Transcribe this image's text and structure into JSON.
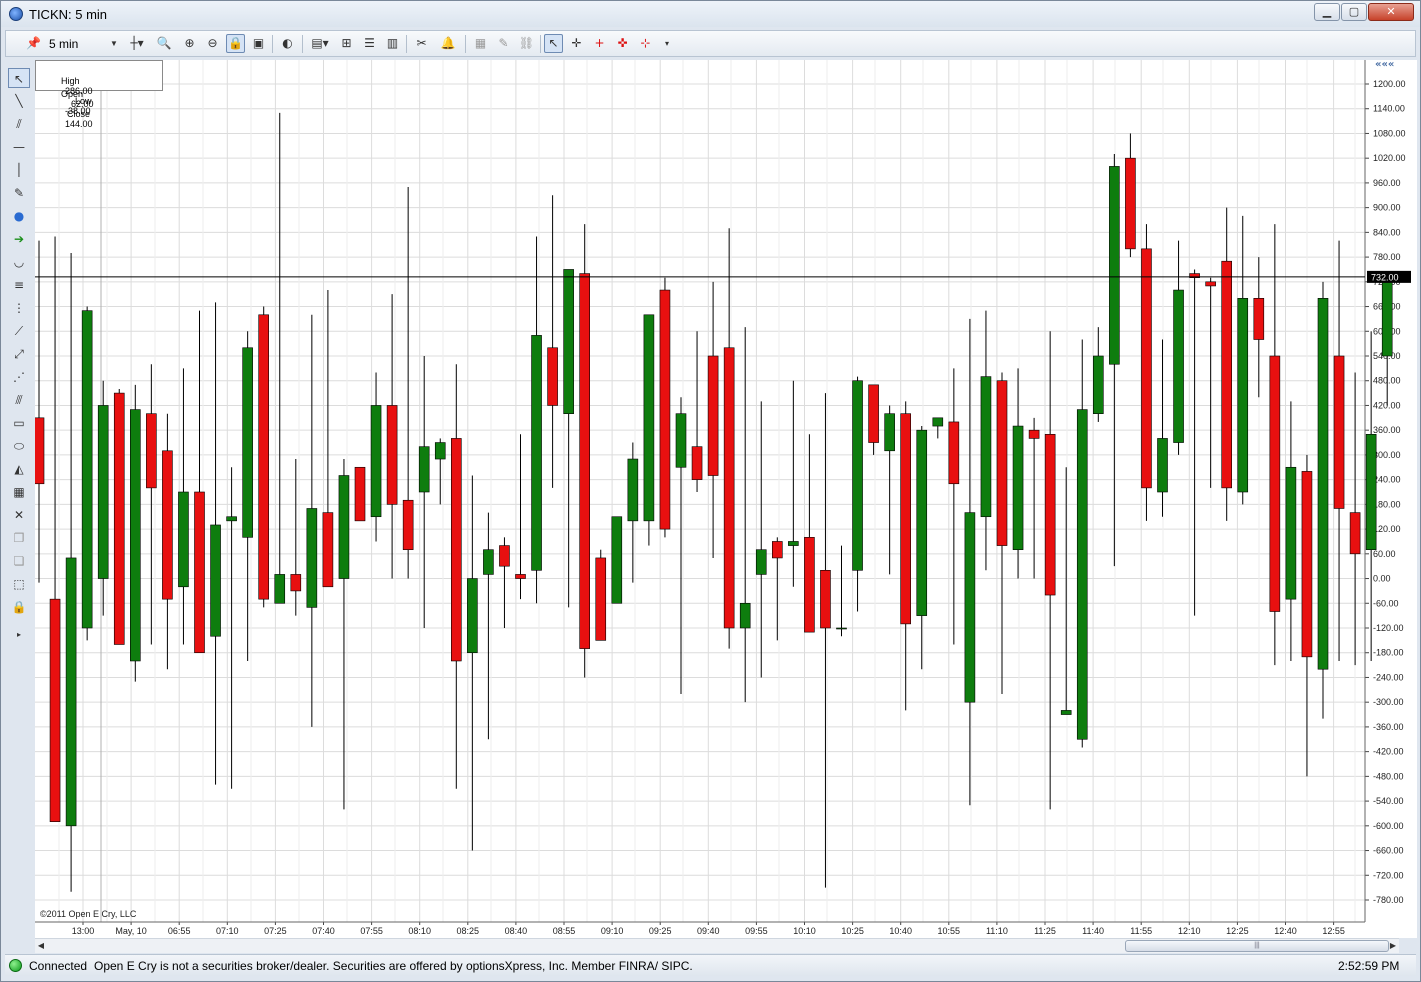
{
  "window": {
    "title": "TICKN: 5 min"
  },
  "toolbar": {
    "interval": "5 min"
  },
  "ohlc": {
    "high_label": "High",
    "high": "286.00",
    "low_label": "Low",
    "low": "-38.00",
    "open_label": "Open",
    "open": "62.00",
    "close_label": "Close",
    "close": "144.00"
  },
  "copyright": "©2011 Open E Cry, LLC",
  "last_price_label": "732.00",
  "status": {
    "connection": "Connected",
    "message": "Open E Cry is not a securities broker/dealer. Securities are offered by optionsXpress, Inc. Member FINRA/ SIPC.",
    "time": "2:52:59 PM"
  },
  "colors": {
    "up": "#0e7d0e",
    "down": "#e81010",
    "grid": "#dcdcdc"
  },
  "chart_data": {
    "type": "candlestick",
    "title": "TICKN: 5 min",
    "ylim": [
      -780,
      1200
    ],
    "y_ticks": [
      1200,
      1140,
      1080,
      1020,
      960,
      900,
      840,
      780,
      720,
      660,
      600,
      540,
      480,
      420,
      360,
      300,
      240,
      180,
      120,
      60,
      0,
      -60,
      -120,
      -180,
      -240,
      -300,
      -360,
      -420,
      -480,
      -540,
      -600,
      -660,
      -720,
      -780
    ],
    "x_labels": [
      "13:00",
      "May, 10",
      "06:55",
      "07:10",
      "07:25",
      "07:40",
      "07:55",
      "08:10",
      "08:25",
      "08:40",
      "08:55",
      "09:10",
      "09:25",
      "09:40",
      "09:55",
      "10:10",
      "10:25",
      "10:40",
      "10:55",
      "11:10",
      "11:25",
      "11:40",
      "11:55",
      "12:10",
      "12:25",
      "12:40",
      "12:55"
    ],
    "horizontal_line": 732,
    "grid": true,
    "candles": [
      {
        "o": 390,
        "h": 820,
        "l": -10,
        "c": 230
      },
      {
        "o": -50,
        "h": 830,
        "l": -590,
        "c": -590
      },
      {
        "o": -600,
        "h": 790,
        "l": -760,
        "c": 50
      },
      {
        "o": -120,
        "h": 660,
        "l": -150,
        "c": 650
      },
      {
        "o": 0,
        "h": 480,
        "l": -90,
        "c": 420
      },
      {
        "o": 450,
        "h": 460,
        "l": -160,
        "c": -160
      },
      {
        "o": -200,
        "h": 470,
        "l": -250,
        "c": 410
      },
      {
        "o": 400,
        "h": 520,
        "l": -160,
        "c": 220
      },
      {
        "o": 310,
        "h": 400,
        "l": -220,
        "c": -50
      },
      {
        "o": -20,
        "h": 510,
        "l": -160,
        "c": 210
      },
      {
        "o": 210,
        "h": 650,
        "l": -40,
        "c": -180
      },
      {
        "o": -140,
        "h": 670,
        "l": -500,
        "c": 130
      },
      {
        "o": 140,
        "h": 270,
        "l": -510,
        "c": 150
      },
      {
        "o": 100,
        "h": 600,
        "l": -200,
        "c": 560
      },
      {
        "o": 640,
        "h": 660,
        "l": -70,
        "c": -50
      },
      {
        "o": -60,
        "h": 1130,
        "l": -60,
        "c": 10
      },
      {
        "o": 10,
        "h": 290,
        "l": -90,
        "c": -30
      },
      {
        "o": -70,
        "h": 640,
        "l": -360,
        "c": 170
      },
      {
        "o": 160,
        "h": 700,
        "l": -10,
        "c": -20
      },
      {
        "o": 0,
        "h": 290,
        "l": -560,
        "c": 250
      },
      {
        "o": 270,
        "h": 270,
        "l": 170,
        "c": 140
      },
      {
        "o": 150,
        "h": 500,
        "l": 90,
        "c": 420
      },
      {
        "o": 420,
        "h": 690,
        "l": 0,
        "c": 180
      },
      {
        "o": 190,
        "h": 950,
        "l": 0,
        "c": 70
      },
      {
        "o": 210,
        "h": 540,
        "l": -120,
        "c": 320
      },
      {
        "o": 290,
        "h": 340,
        "l": 180,
        "c": 330
      },
      {
        "o": 340,
        "h": 520,
        "l": -510,
        "c": -200
      },
      {
        "o": -180,
        "h": 250,
        "l": -660,
        "c": 0
      },
      {
        "o": 10,
        "h": 160,
        "l": -390,
        "c": 70
      },
      {
        "o": 80,
        "h": 100,
        "l": -120,
        "c": 30
      },
      {
        "o": 10,
        "h": 350,
        "l": -50,
        "c": 0
      },
      {
        "o": 20,
        "h": 830,
        "l": -60,
        "c": 590
      },
      {
        "o": 560,
        "h": 930,
        "l": 220,
        "c": 420
      },
      {
        "o": 400,
        "h": 750,
        "l": -70,
        "c": 750
      },
      {
        "o": 740,
        "h": 860,
        "l": -240,
        "c": -170
      },
      {
        "o": 50,
        "h": 70,
        "l": -150,
        "c": -150
      },
      {
        "o": -60,
        "h": 130,
        "l": -40,
        "c": 150
      },
      {
        "o": 140,
        "h": 330,
        "l": -10,
        "c": 290
      },
      {
        "o": 140,
        "h": 350,
        "l": 80,
        "c": 640
      },
      {
        "o": 700,
        "h": 730,
        "l": 100,
        "c": 120
      },
      {
        "o": 270,
        "h": 440,
        "l": -280,
        "c": 400
      },
      {
        "o": 320,
        "h": 600,
        "l": 210,
        "c": 240
      },
      {
        "o": 540,
        "h": 720,
        "l": 50,
        "c": 250
      },
      {
        "o": 560,
        "h": 850,
        "l": -170,
        "c": -120
      },
      {
        "o": -120,
        "h": 610,
        "l": -300,
        "c": -60
      },
      {
        "o": 10,
        "h": 430,
        "l": -240,
        "c": 70
      },
      {
        "o": 90,
        "h": 100,
        "l": -150,
        "c": 50
      },
      {
        "o": 80,
        "h": 480,
        "l": -20,
        "c": 90
      },
      {
        "o": 100,
        "h": 350,
        "l": -130,
        "c": -130
      },
      {
        "o": 20,
        "h": 450,
        "l": -750,
        "c": -120
      },
      {
        "o": -120,
        "h": 80,
        "l": -140,
        "c": -120
      },
      {
        "o": 20,
        "h": 490,
        "l": -80,
        "c": 480
      },
      {
        "o": 470,
        "h": 460,
        "l": 300,
        "c": 330
      },
      {
        "o": 310,
        "h": 420,
        "l": 10,
        "c": 400
      },
      {
        "o": 400,
        "h": 430,
        "l": -320,
        "c": -110
      },
      {
        "o": -90,
        "h": 370,
        "l": -220,
        "c": 360
      },
      {
        "o": 370,
        "h": 390,
        "l": 340,
        "c": 390
      },
      {
        "o": 380,
        "h": 510,
        "l": -160,
        "c": 230
      },
      {
        "o": -300,
        "h": 630,
        "l": -550,
        "c": 160
      },
      {
        "o": 150,
        "h": 650,
        "l": 20,
        "c": 490
      },
      {
        "o": 480,
        "h": 500,
        "l": -280,
        "c": 80
      },
      {
        "o": 70,
        "h": 510,
        "l": 0,
        "c": 370
      },
      {
        "o": 360,
        "h": 390,
        "l": 0,
        "c": 340
      },
      {
        "o": 350,
        "h": 600,
        "l": -560,
        "c": -40
      },
      {
        "o": -330,
        "h": 270,
        "l": -330,
        "c": -320
      },
      {
        "o": -390,
        "h": 580,
        "l": -410,
        "c": 410
      },
      {
        "o": 400,
        "h": 610,
        "l": 380,
        "c": 540
      },
      {
        "o": 520,
        "h": 1030,
        "l": 30,
        "c": 1000
      },
      {
        "o": 1020,
        "h": 1080,
        "l": 780,
        "c": 800
      },
      {
        "o": 800,
        "h": 860,
        "l": 140,
        "c": 220
      },
      {
        "o": 210,
        "h": 580,
        "l": 150,
        "c": 340
      },
      {
        "o": 330,
        "h": 820,
        "l": 300,
        "c": 700
      },
      {
        "o": 740,
        "h": 750,
        "l": -90,
        "c": 730
      },
      {
        "o": 720,
        "h": 730,
        "l": 220,
        "c": 710
      },
      {
        "o": 770,
        "h": 900,
        "l": 140,
        "c": 220
      },
      {
        "o": 210,
        "h": 880,
        "l": 180,
        "c": 680
      },
      {
        "o": 680,
        "h": 780,
        "l": 440,
        "c": 580
      },
      {
        "o": 540,
        "h": 860,
        "l": -210,
        "c": -80
      },
      {
        "o": -50,
        "h": 430,
        "l": -200,
        "c": 270
      },
      {
        "o": 260,
        "h": 300,
        "l": -480,
        "c": -190
      },
      {
        "o": -220,
        "h": 720,
        "l": -340,
        "c": 680
      },
      {
        "o": 540,
        "h": 820,
        "l": -200,
        "c": 170
      },
      {
        "o": 160,
        "h": 500,
        "l": -210,
        "c": 60
      },
      {
        "o": 70,
        "h": 600,
        "l": -200,
        "c": 350
      },
      {
        "o": 540,
        "h": 740,
        "l": 420,
        "c": 740
      }
    ]
  }
}
